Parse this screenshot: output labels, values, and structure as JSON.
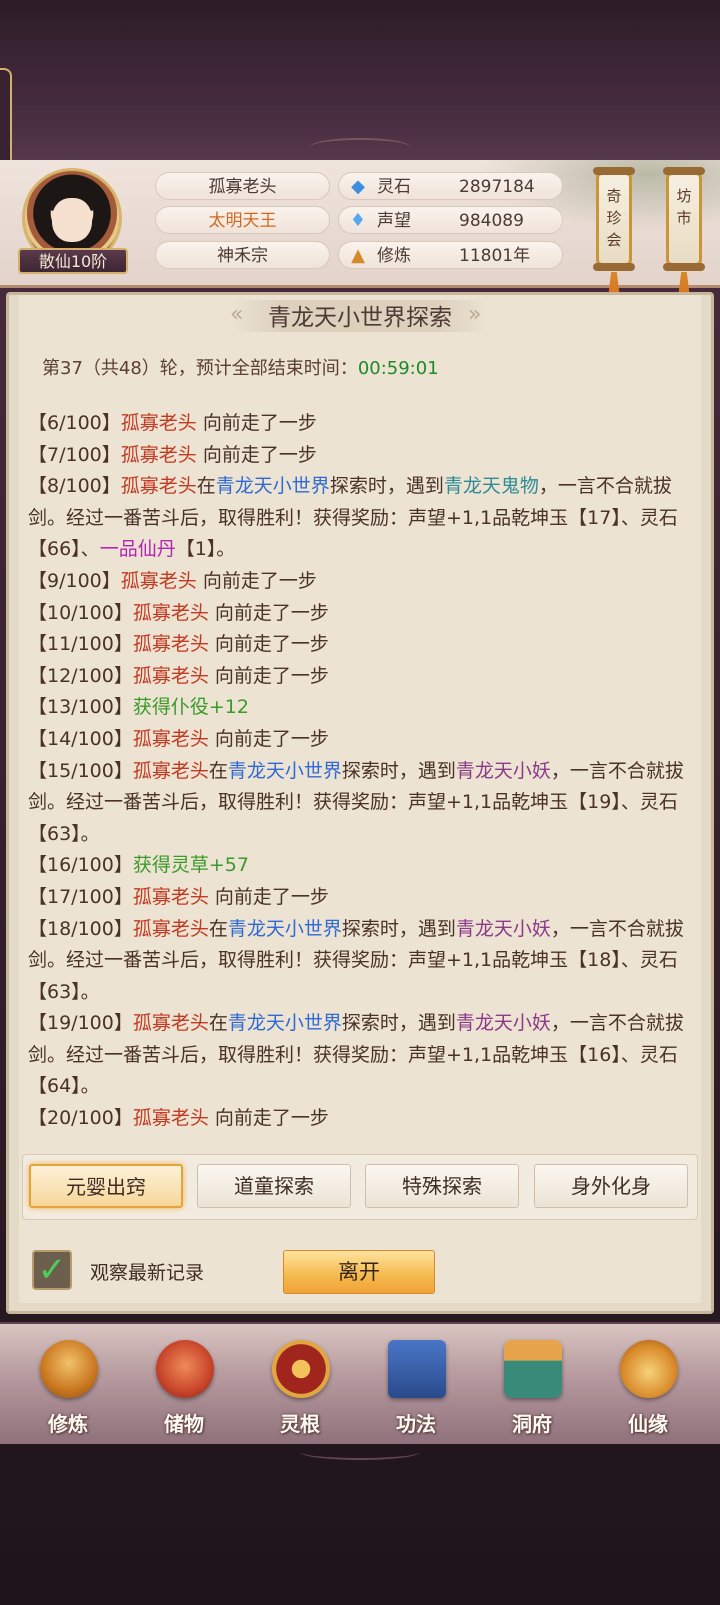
{
  "header": {
    "rank": "散仙10阶",
    "names": [
      "孤寡老头",
      "太明天王",
      "神禾宗"
    ],
    "stats": [
      {
        "icon": "spirit-stone-icon",
        "label": "灵石",
        "value": "2897184"
      },
      {
        "icon": "prestige-icon",
        "label": "声望",
        "value": "984089"
      },
      {
        "icon": "cultivation-icon",
        "label": "修炼",
        "value": "11801年"
      }
    ],
    "shop_buttons": [
      "奇珍会",
      "坊市"
    ]
  },
  "panel": {
    "title": "青龙天小世界探索",
    "round_text": "第37（共48）轮，预计全部结束时间：",
    "round_time": "00:59:01"
  },
  "log": [
    [
      {
        "t": "【6/100】",
        "c": ""
      },
      {
        "t": "孤寡老头",
        "c": "red"
      },
      {
        "t": " 向前走了一步",
        "c": ""
      }
    ],
    [
      {
        "t": "【7/100】",
        "c": ""
      },
      {
        "t": "孤寡老头",
        "c": "red"
      },
      {
        "t": " 向前走了一步",
        "c": ""
      }
    ],
    [
      {
        "t": "【8/100】",
        "c": ""
      },
      {
        "t": "孤寡老头",
        "c": "red"
      },
      {
        "t": "在",
        "c": ""
      },
      {
        "t": "青龙天小世界",
        "c": "blue"
      },
      {
        "t": "探索时，遇到",
        "c": ""
      },
      {
        "t": "青龙天鬼物",
        "c": "teal"
      },
      {
        "t": "，一言不合就拔剑。经过一番苦斗后，取得胜利！获得奖励：声望+1,1品乾坤玉【17】、灵石【66】、",
        "c": ""
      },
      {
        "t": "一品仙丹",
        "c": "purple"
      },
      {
        "t": "【1】。",
        "c": ""
      }
    ],
    [
      {
        "t": "【9/100】",
        "c": ""
      },
      {
        "t": "孤寡老头",
        "c": "red"
      },
      {
        "t": " 向前走了一步",
        "c": ""
      }
    ],
    [
      {
        "t": "【10/100】",
        "c": ""
      },
      {
        "t": "孤寡老头",
        "c": "red"
      },
      {
        "t": " 向前走了一步",
        "c": ""
      }
    ],
    [
      {
        "t": "【11/100】",
        "c": ""
      },
      {
        "t": "孤寡老头",
        "c": "red"
      },
      {
        "t": " 向前走了一步",
        "c": ""
      }
    ],
    [
      {
        "t": "【12/100】",
        "c": ""
      },
      {
        "t": "孤寡老头",
        "c": "red"
      },
      {
        "t": " 向前走了一步",
        "c": ""
      }
    ],
    [
      {
        "t": "【13/100】",
        "c": ""
      },
      {
        "t": "获得仆役+12",
        "c": "green"
      }
    ],
    [
      {
        "t": "【14/100】",
        "c": ""
      },
      {
        "t": "孤寡老头",
        "c": "red"
      },
      {
        "t": " 向前走了一步",
        "c": ""
      }
    ],
    [
      {
        "t": "【15/100】",
        "c": ""
      },
      {
        "t": "孤寡老头",
        "c": "red"
      },
      {
        "t": "在",
        "c": ""
      },
      {
        "t": "青龙天小世界",
        "c": "blue"
      },
      {
        "t": "探索时，遇到",
        "c": ""
      },
      {
        "t": "青龙天小妖",
        "c": "pink"
      },
      {
        "t": "，一言不合就拔剑。经过一番苦斗后，取得胜利！获得奖励：声望+1,1品乾坤玉【19】、灵石【63】。",
        "c": ""
      }
    ],
    [
      {
        "t": "【16/100】",
        "c": ""
      },
      {
        "t": "获得灵草+57",
        "c": "green"
      }
    ],
    [
      {
        "t": "【17/100】",
        "c": ""
      },
      {
        "t": "孤寡老头",
        "c": "red"
      },
      {
        "t": " 向前走了一步",
        "c": ""
      }
    ],
    [
      {
        "t": "【18/100】",
        "c": ""
      },
      {
        "t": "孤寡老头",
        "c": "red"
      },
      {
        "t": "在",
        "c": ""
      },
      {
        "t": "青龙天小世界",
        "c": "blue"
      },
      {
        "t": "探索时，遇到",
        "c": ""
      },
      {
        "t": "青龙天小妖",
        "c": "pink"
      },
      {
        "t": "，一言不合就拔剑。经过一番苦斗后，取得胜利！获得奖励：声望+1,1品乾坤玉【18】、灵石【63】。",
        "c": ""
      }
    ],
    [
      {
        "t": "【19/100】",
        "c": ""
      },
      {
        "t": "孤寡老头",
        "c": "red"
      },
      {
        "t": "在",
        "c": ""
      },
      {
        "t": "青龙天小世界",
        "c": "blue"
      },
      {
        "t": "探索时，遇到",
        "c": ""
      },
      {
        "t": "青龙天小妖",
        "c": "pink"
      },
      {
        "t": "，一言不合就拔剑。经过一番苦斗后，取得胜利！获得奖励：声望+1,1品乾坤玉【16】、灵石【64】。",
        "c": ""
      }
    ],
    [
      {
        "t": "【20/100】",
        "c": ""
      },
      {
        "t": "孤寡老头",
        "c": "red"
      },
      {
        "t": " 向前走了一步",
        "c": ""
      }
    ]
  ],
  "tabs": [
    "元婴出窍",
    "道童探索",
    "特殊探索",
    "身外化身"
  ],
  "active_tab": 0,
  "watch_latest": {
    "label": "观察最新记录",
    "checked": true
  },
  "leave_button": "离开",
  "bottom_nav": [
    {
      "label": "修炼",
      "icon": "cultivate-icon"
    },
    {
      "label": "储物",
      "icon": "storage-bag-icon"
    },
    {
      "label": "灵根",
      "icon": "spirit-root-icon"
    },
    {
      "label": "功法",
      "icon": "scripture-book-icon"
    },
    {
      "label": "洞府",
      "icon": "cave-mansion-icon"
    },
    {
      "label": "仙缘",
      "icon": "gourd-icon"
    }
  ],
  "colors": {
    "accent": "#f4b94b",
    "timer": "#1f8a2c",
    "name": "#c33a22",
    "place": "#2f6ad6",
    "reward": "#3c9a2a"
  }
}
